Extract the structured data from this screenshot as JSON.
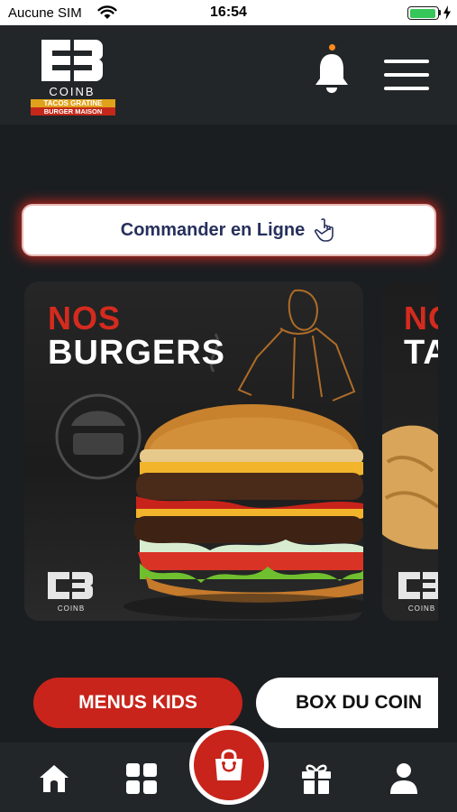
{
  "status_bar": {
    "carrier": "Aucune SIM",
    "time": "16:54",
    "battery_level": 0.95,
    "battery_color": "#35c759"
  },
  "header": {
    "logo": {
      "name": "COINB",
      "tagline_1": "TACOS GRATINE",
      "tagline_2": "BURGER MAISON"
    },
    "notification_icon": "bell-icon",
    "notification_dot_color": "#ff8a1c",
    "menu_icon": "hamburger-menu-icon"
  },
  "order_button": {
    "label": "Commander en Ligne",
    "icon": "pointing-hand-icon",
    "glow_color": "#e6281e"
  },
  "carousel": [
    {
      "title_top": "NOS",
      "title_bottom": "BURGERS",
      "brand": "COINB"
    },
    {
      "title_top": "NO",
      "title_bottom": "TA",
      "brand": "COINB"
    }
  ],
  "categories": [
    {
      "label": "MENUS KIDS",
      "style": "red"
    },
    {
      "label": "BOX DU COIN",
      "style": "white"
    }
  ],
  "bottom_nav": [
    {
      "icon": "home-icon"
    },
    {
      "icon": "grid-icon"
    },
    {
      "icon": "shopping-bag-icon",
      "featured": true
    },
    {
      "icon": "gift-icon"
    },
    {
      "icon": "user-icon"
    }
  ],
  "colors": {
    "background": "#1b1e21",
    "header": "#222629",
    "accent_red": "#c8241b",
    "order_text": "#26305c"
  }
}
